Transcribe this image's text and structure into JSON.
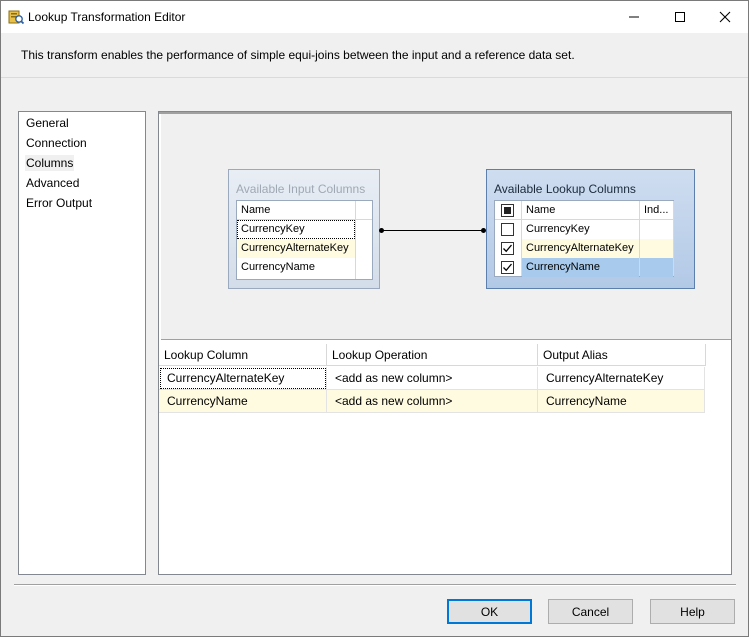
{
  "window": {
    "title": "Lookup Transformation Editor",
    "icon": "ssis-lookup-icon",
    "controls": [
      "minimize-icon",
      "maximize-icon",
      "close-icon"
    ]
  },
  "description": "This transform enables the performance of simple equi-joins between the input and a reference data set.",
  "nav": {
    "items": [
      {
        "label": "General",
        "selected": false
      },
      {
        "label": "Connection",
        "selected": false
      },
      {
        "label": "Columns",
        "selected": true
      },
      {
        "label": "Advanced",
        "selected": false
      },
      {
        "label": "Error Output",
        "selected": false
      }
    ]
  },
  "input_columns": {
    "title": "Available Input Columns",
    "header": "Name",
    "rows": [
      {
        "name": "CurrencyKey",
        "state": "focused"
      },
      {
        "name": "CurrencyAlternateKey",
        "state": "mapped"
      },
      {
        "name": "CurrencyName",
        "state": "normal"
      }
    ]
  },
  "lookup_columns": {
    "title": "Available Lookup Columns",
    "headers": {
      "name": "Name",
      "index": "Ind..."
    },
    "rows": [
      {
        "name": "CurrencyKey",
        "checked": false,
        "state": "normal"
      },
      {
        "name": "CurrencyAlternateKey",
        "checked": true,
        "state": "mapped"
      },
      {
        "name": "CurrencyName",
        "checked": true,
        "state": "selected"
      }
    ]
  },
  "lookup_grid": {
    "headers": [
      "Lookup Column",
      "Lookup Operation",
      "Output Alias"
    ],
    "rows": [
      {
        "column": "CurrencyAlternateKey",
        "operation": "<add as new column>",
        "alias": "CurrencyAlternateKey"
      },
      {
        "column": "CurrencyName",
        "operation": "<add as new column>",
        "alias": "CurrencyName"
      }
    ]
  },
  "buttons": {
    "ok": "OK",
    "cancel": "Cancel",
    "help": "Help"
  },
  "colors": {
    "mapped_row": "#fffbe0",
    "selected_row": "#a8cbed",
    "default_button_border": "#0078d7"
  }
}
